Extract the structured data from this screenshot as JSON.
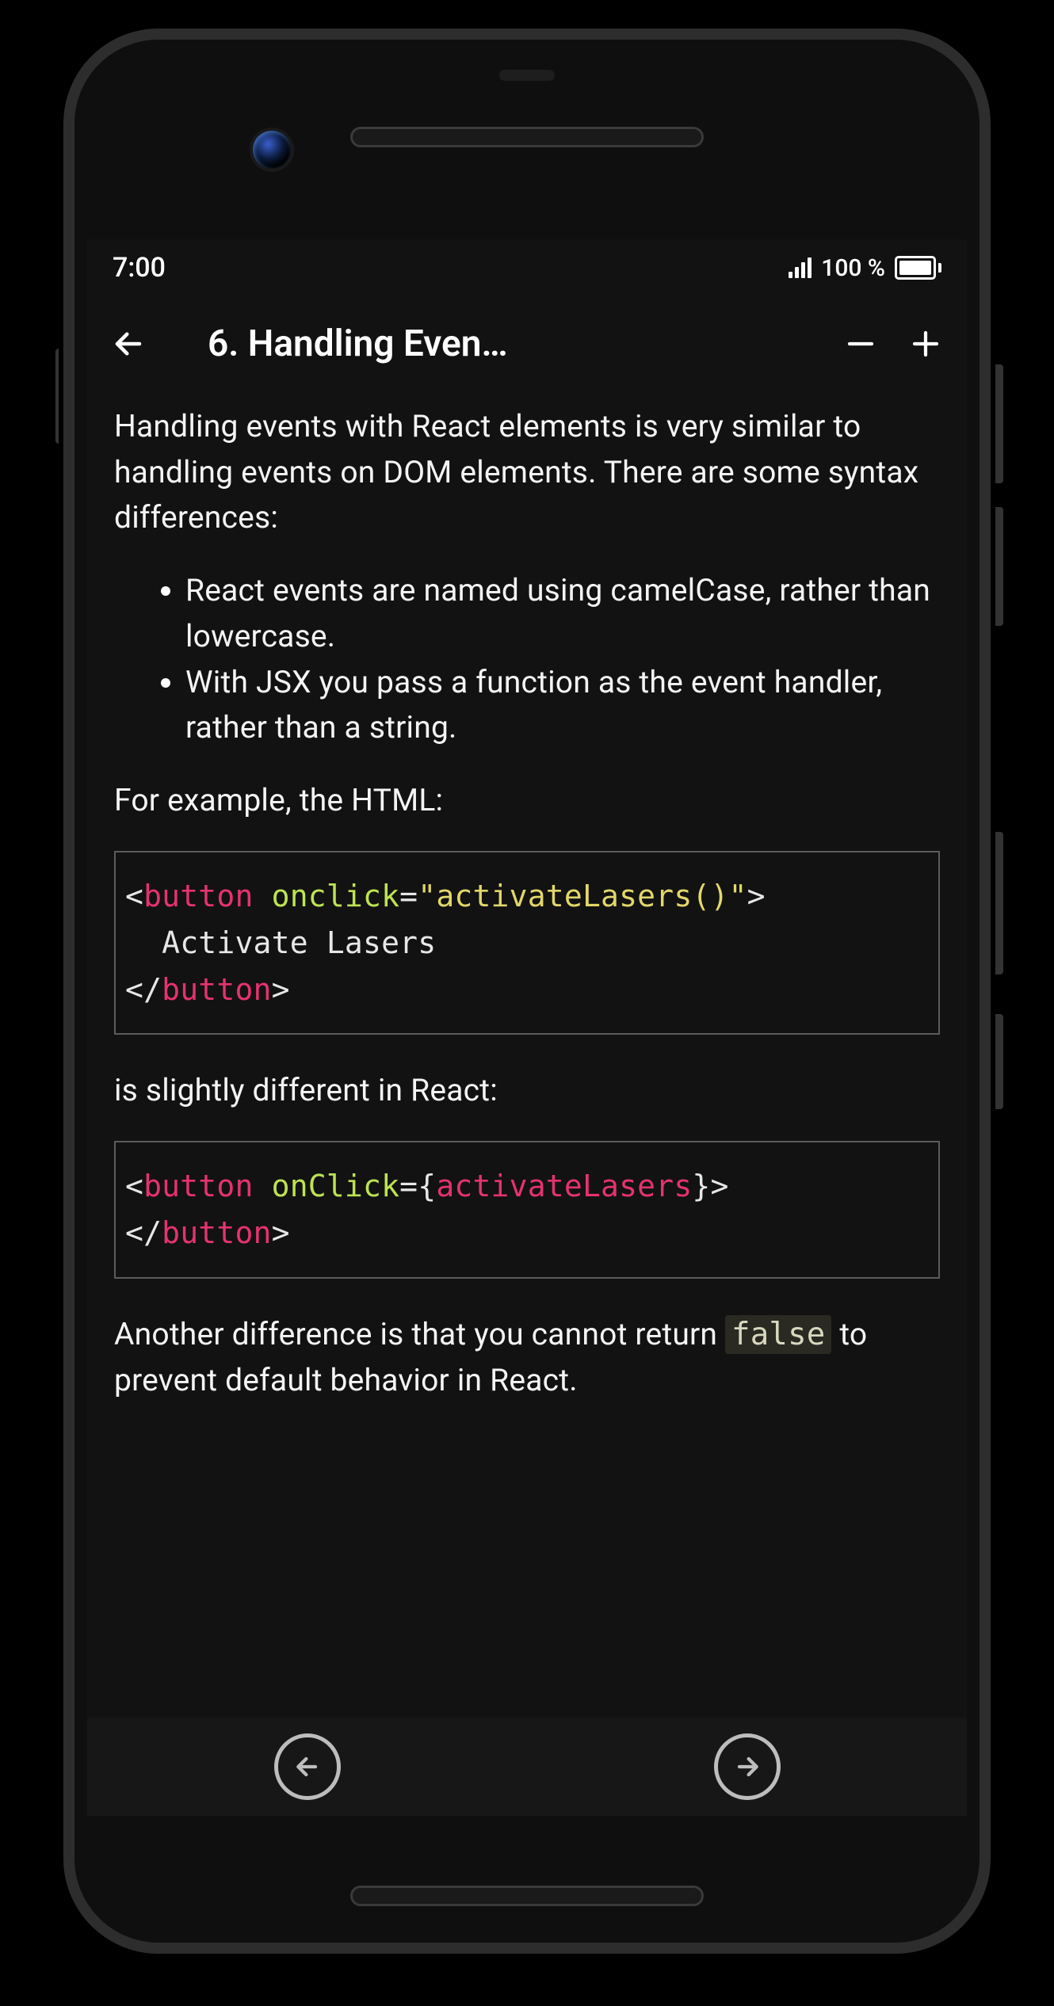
{
  "statusbar": {
    "time": "7:00",
    "battery_text": "100 %"
  },
  "header": {
    "title": "6. Handling Even…"
  },
  "content": {
    "intro": "Handling events with React elements is very similar to handling events on DOM elements. There are some syntax differences:",
    "bullets": [
      "React events are named using camelCase, rather than lowercase.",
      "With JSX you pass a function as the event handler, rather than a string."
    ],
    "example_lead": "For example, the HTML:",
    "code1": {
      "open_bracket": "<",
      "tag1": "button",
      "space": " ",
      "attr": "onclick",
      "eq": "=",
      "str": "\"activateLasers()\"",
      "close_bracket": ">",
      "body": "  Activate Lasers",
      "close_open": "</",
      "tag2": "button",
      "close_close": ">"
    },
    "mid": "is slightly different in React:",
    "code2": {
      "open_bracket": "<",
      "tag1": "button",
      "space": " ",
      "attr": "onClick",
      "eq": "=",
      "lbrace": "{",
      "var": "activateLasers",
      "rbrace": "}",
      "close_bracket": ">",
      "close_open": "</",
      "tag2": "button",
      "close_close": ">"
    },
    "outro_pre": "Another difference is that you cannot return ",
    "outro_code": "false",
    "outro_post": " to prevent default behavior in React."
  }
}
